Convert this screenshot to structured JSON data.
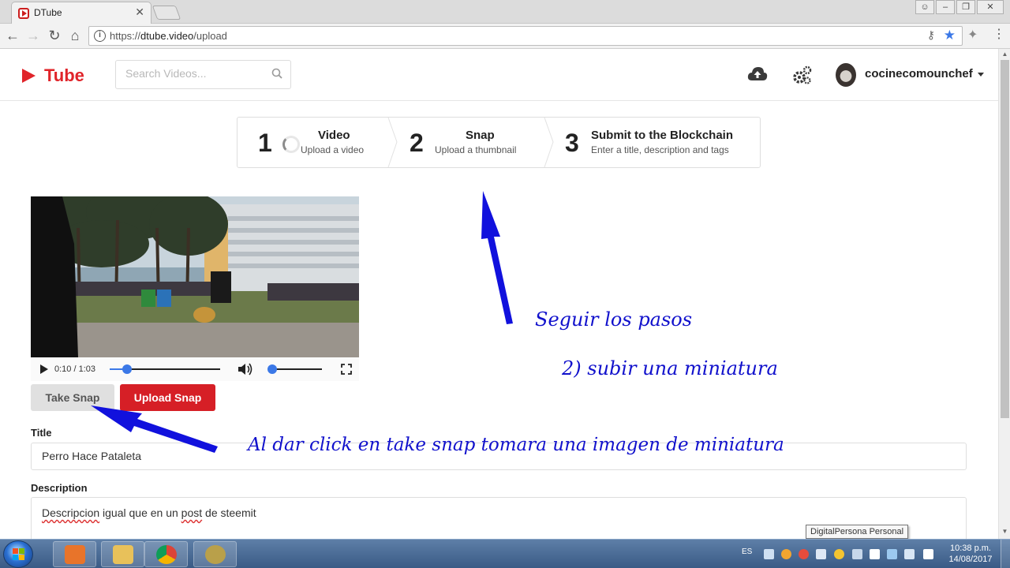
{
  "browser": {
    "tab_title": "DTube",
    "url_scheme": "https://",
    "url_host": "dtube.video",
    "url_path": "/upload"
  },
  "site": {
    "logo_text": "Tube",
    "search_placeholder": "Search Videos...",
    "username": "cocinecomounchef",
    "brand_color": "#e0242a"
  },
  "steps": [
    {
      "number": "1",
      "title": "Video",
      "subtitle": "Upload a video"
    },
    {
      "number": "2",
      "title": "Snap",
      "subtitle": "Upload a thumbnail"
    },
    {
      "number": "3",
      "title": "Submit to the Blockchain",
      "subtitle": "Enter a title, description and tags"
    }
  ],
  "player": {
    "time": "0:10 / 1:03",
    "progress": 0.16,
    "volume": 0.0
  },
  "buttons": {
    "take_snap": "Take Snap",
    "upload_snap": "Upload Snap"
  },
  "form": {
    "title_label": "Title",
    "title_value": "Perro Hace Pataleta",
    "description_label": "Description",
    "description_words": [
      "Descripcion",
      " igual que en un ",
      "post",
      " de steemit"
    ]
  },
  "annotations": {
    "follow_steps": "Seguir los pasos",
    "step2": "2) subir una miniatura",
    "take_snap_hint": "Al dar click en take snap tomara una imagen de miniatura",
    "color": "#1111cc"
  },
  "tooltip": "DigitalPersona Personal",
  "taskbar": {
    "language": "ES",
    "time": "10:38 p.m.",
    "date": "14/08/2017"
  }
}
